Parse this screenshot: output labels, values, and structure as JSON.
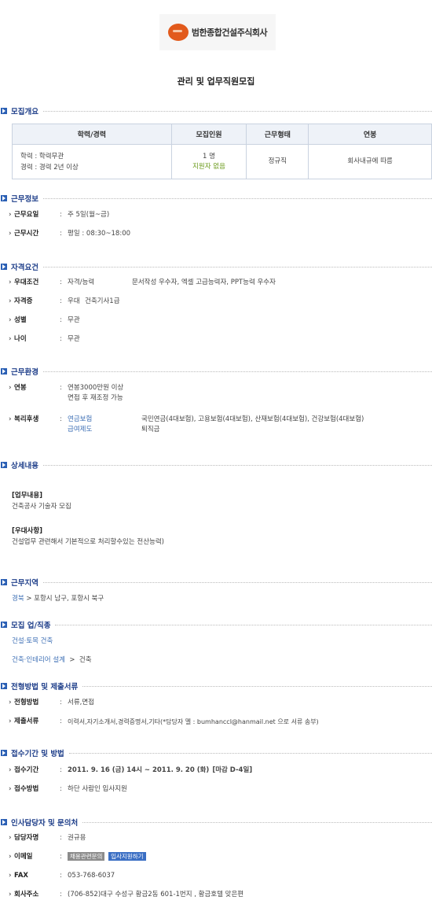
{
  "company": {
    "name": "범한종합건설주식회사"
  },
  "title": "관리 및 업무직원모집",
  "sections": {
    "recruit": "모집개요",
    "work": "근무정보",
    "qual": "자격요건",
    "env": "근무환경",
    "detail": "상세내용",
    "area": "근무지역",
    "job": "모집 업/직종",
    "process": "전형방법 및 제출서류",
    "period": "접수기간 및 방법",
    "contact": "인사담당자 및 문의처"
  },
  "table": {
    "headers": [
      "학력/경력",
      "모집인원",
      "근무형태",
      "연봉"
    ],
    "edu": "학력 : 학력무관",
    "career": "경력 : 경력 2년 이상",
    "count": "1 명",
    "count_note": "지원자 없음",
    "type": "정규직",
    "salary": "회사내규에 따름"
  },
  "work": {
    "days_label": "근무요일",
    "days": "주 5일(월~금)",
    "hours_label": "근무시간",
    "hours": "평일 : 08:30~18:00"
  },
  "qual": {
    "pref_label": "우대조건",
    "pref_key": "자격/능력",
    "pref_val": "문서작성 우수자, 엑셀 고급능력자, PPT능력 우수자",
    "cert_label": "자격증",
    "cert_key": "우대",
    "cert_val": "건축기사1급",
    "gender_label": "성별",
    "gender": "무관",
    "age_label": "나이",
    "age": "무관"
  },
  "env": {
    "salary_label": "연봉",
    "salary": "연봉3000만원 이상",
    "salary_note": "면접 후 재조정 가능",
    "benefit_label": "복리후생",
    "ins_key": "연금보험",
    "ins_val": "국민연금(4대보험), 고용보험(4대보험), 산재보험(4대보험), 건강보험(4대보험)",
    "pay_key": "급여제도",
    "pay_val": "퇴직금"
  },
  "detail": {
    "duty_title": "[업무내용]",
    "duty": "건축공사 기술자 모집",
    "pref_title": "[우대사항]",
    "pref": "건설업무 관련해서 기본적으로 처리할수있는 전산능력)"
  },
  "area": {
    "region": "경북",
    "sep": ">",
    "cities": "포항시 남구, 포항시 북구"
  },
  "job": {
    "line1": "건설·토목 건축",
    "line2_a": "건축·인테리어 설계",
    "line2_sep": ">",
    "line2_b": "건축"
  },
  "process": {
    "method_label": "전형방법",
    "method": "서류,면접",
    "docs_label": "제출서류",
    "docs": "이력서,자기소개서,경력증명서,기타(*담당자 멜 : bumhanccl@hanmail.net 으로 서류 송부)"
  },
  "period": {
    "period_label": "접수기간",
    "period": "2011. 9. 16 (금) 14시 ~ 2011. 9. 20 (화)",
    "deadline": "[마감 D-4일]",
    "how_label": "접수방법",
    "how": "하단 사람인 입사지원"
  },
  "contact": {
    "person_label": "담당자명",
    "person": "권규용",
    "email_label": "이메일",
    "email_btn1": "채용관련문의",
    "email_btn2": "입사지원하기",
    "fax_label": "FAX",
    "fax": "053-768-6037",
    "addr_label": "회사주소",
    "addr": "(706-852)대구 수성구 황금2동 601-1번지 , 황금호텔 맞은편"
  },
  "colors": {
    "section_blue": "#1f3f8a",
    "link_blue": "#3d6fb5",
    "orange": "#e5821a",
    "green": "#6a9a1a"
  }
}
